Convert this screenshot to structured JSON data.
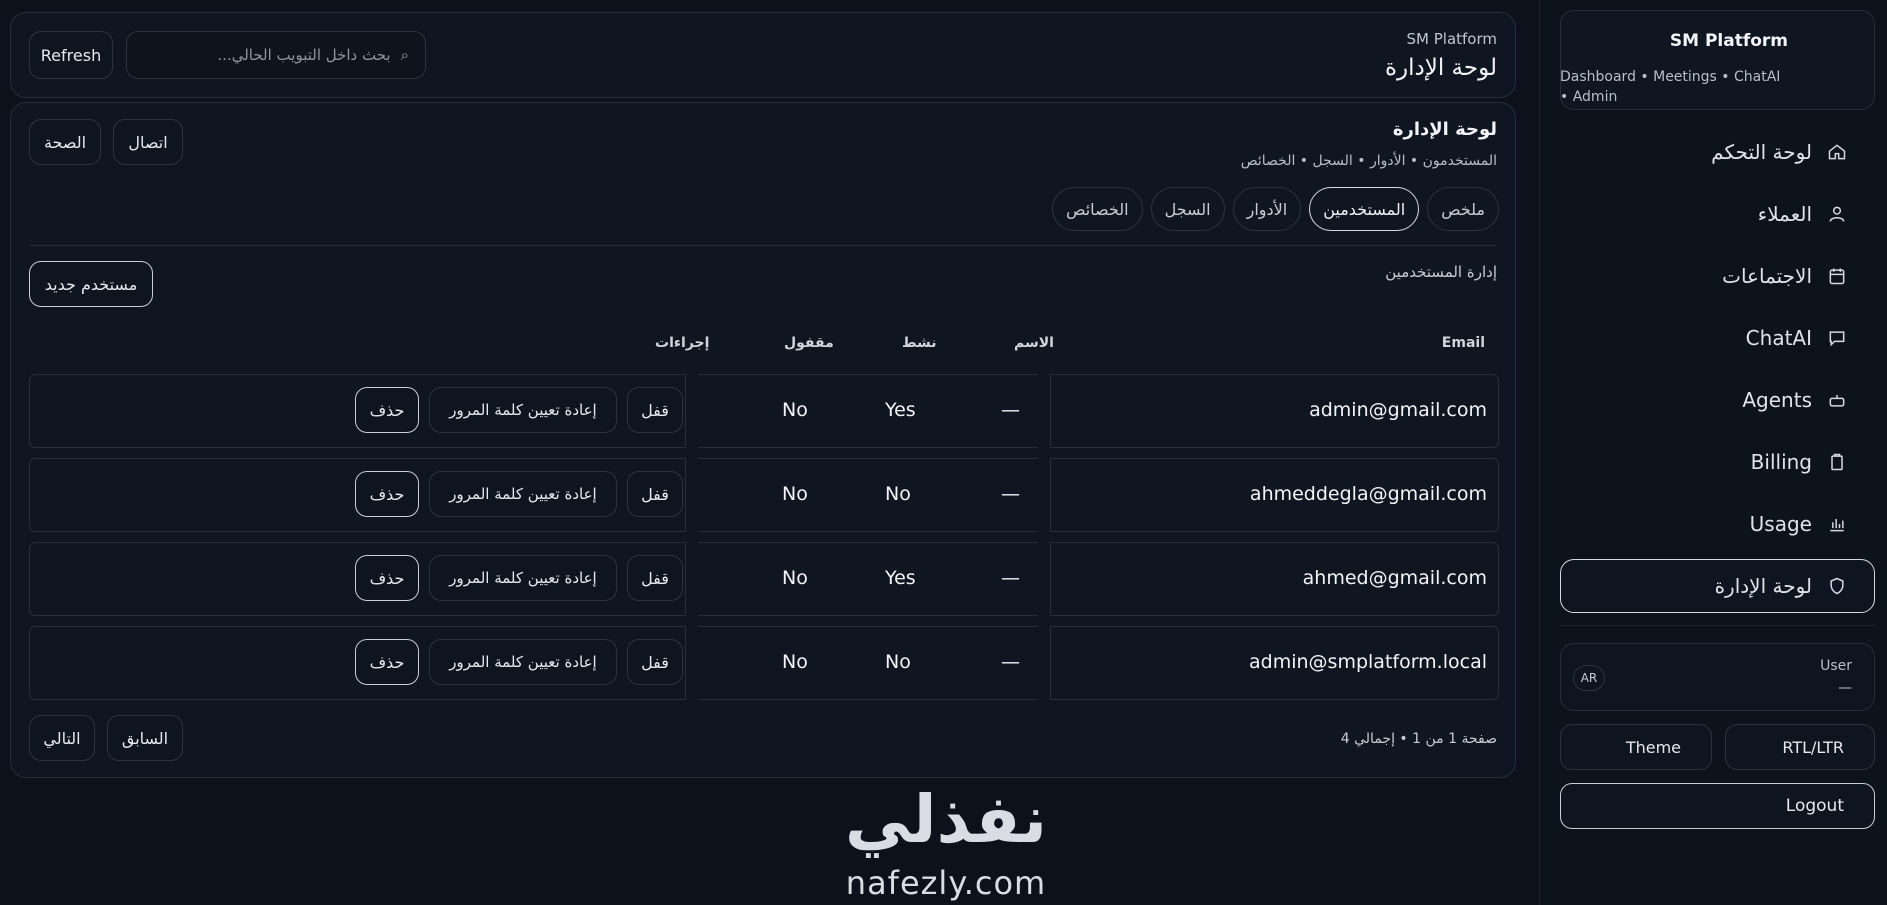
{
  "sidebar": {
    "brand_title": "SM Platform",
    "brand_subtitle": "Dashboard • Meetings • ChatAI • Admin",
    "items": [
      {
        "label": "لوحة التحكم",
        "icon": "home-icon"
      },
      {
        "label": "العملاء",
        "icon": "user-icon"
      },
      {
        "label": "الاجتماعات",
        "icon": "calendar-icon"
      },
      {
        "label": "ChatAI",
        "icon": "chat-icon"
      },
      {
        "label": "Agents",
        "icon": "robot-icon"
      },
      {
        "label": "Billing",
        "icon": "clipboard-icon"
      },
      {
        "label": "Usage",
        "icon": "bar-chart-icon"
      },
      {
        "label": "لوحة الإدارة",
        "icon": "shield-icon",
        "active": true
      }
    ],
    "user_label": "User",
    "user_value": "—",
    "lang": "AR",
    "rtl_label": "RTL/LTR",
    "theme_label": "Theme",
    "logout_label": "Logout"
  },
  "topbar": {
    "crumb": "SM Platform",
    "title": "لوحة الإدارة",
    "search_placeholder": "بحث داخل التبويب الحالي...",
    "refresh_label": "Refresh"
  },
  "panel": {
    "title": "لوحة الإدارة",
    "subtitle": "المستخدمون • الأدوار • السجل • الخصائص",
    "connection_label": "اتصال",
    "health_label": "الصحة",
    "tabs": [
      {
        "label": "ملخص"
      },
      {
        "label": "المستخدمين",
        "active": true
      },
      {
        "label": "الأدوار"
      },
      {
        "label": "السجل"
      },
      {
        "label": "الخصائص"
      }
    ],
    "section_title": "إدارة المستخدمين",
    "new_user_label": "مستخدم جديد"
  },
  "table": {
    "headers": {
      "email": "Email",
      "name": "الاسم",
      "active": "نشط",
      "locked": "مقفول",
      "actions": "إجراءات"
    },
    "rows": [
      {
        "email": "admin@gmail.com",
        "name": "—",
        "active": "Yes",
        "locked": "No"
      },
      {
        "email": "ahmeddegla@gmail.com",
        "name": "—",
        "active": "No",
        "locked": "No"
      },
      {
        "email": "ahmed@gmail.com",
        "name": "—",
        "active": "Yes",
        "locked": "No"
      },
      {
        "email": "admin@smplatform.local",
        "name": "—",
        "active": "No",
        "locked": "No"
      }
    ],
    "lock_label": "قفل",
    "reset_label": "إعادة تعيين كلمة المرور",
    "delete_label": "حذف"
  },
  "pager": {
    "info": "صفحة 1 من 1 • إجمالي 4",
    "prev_label": "السابق",
    "next_label": "التالي"
  },
  "watermark": {
    "arabic": "نفذلي",
    "latin": "nafezly.com"
  },
  "colors": {
    "background": "#0c111b",
    "surface": "#101621",
    "border": "#262e3b",
    "text": "#e6e9ef"
  }
}
